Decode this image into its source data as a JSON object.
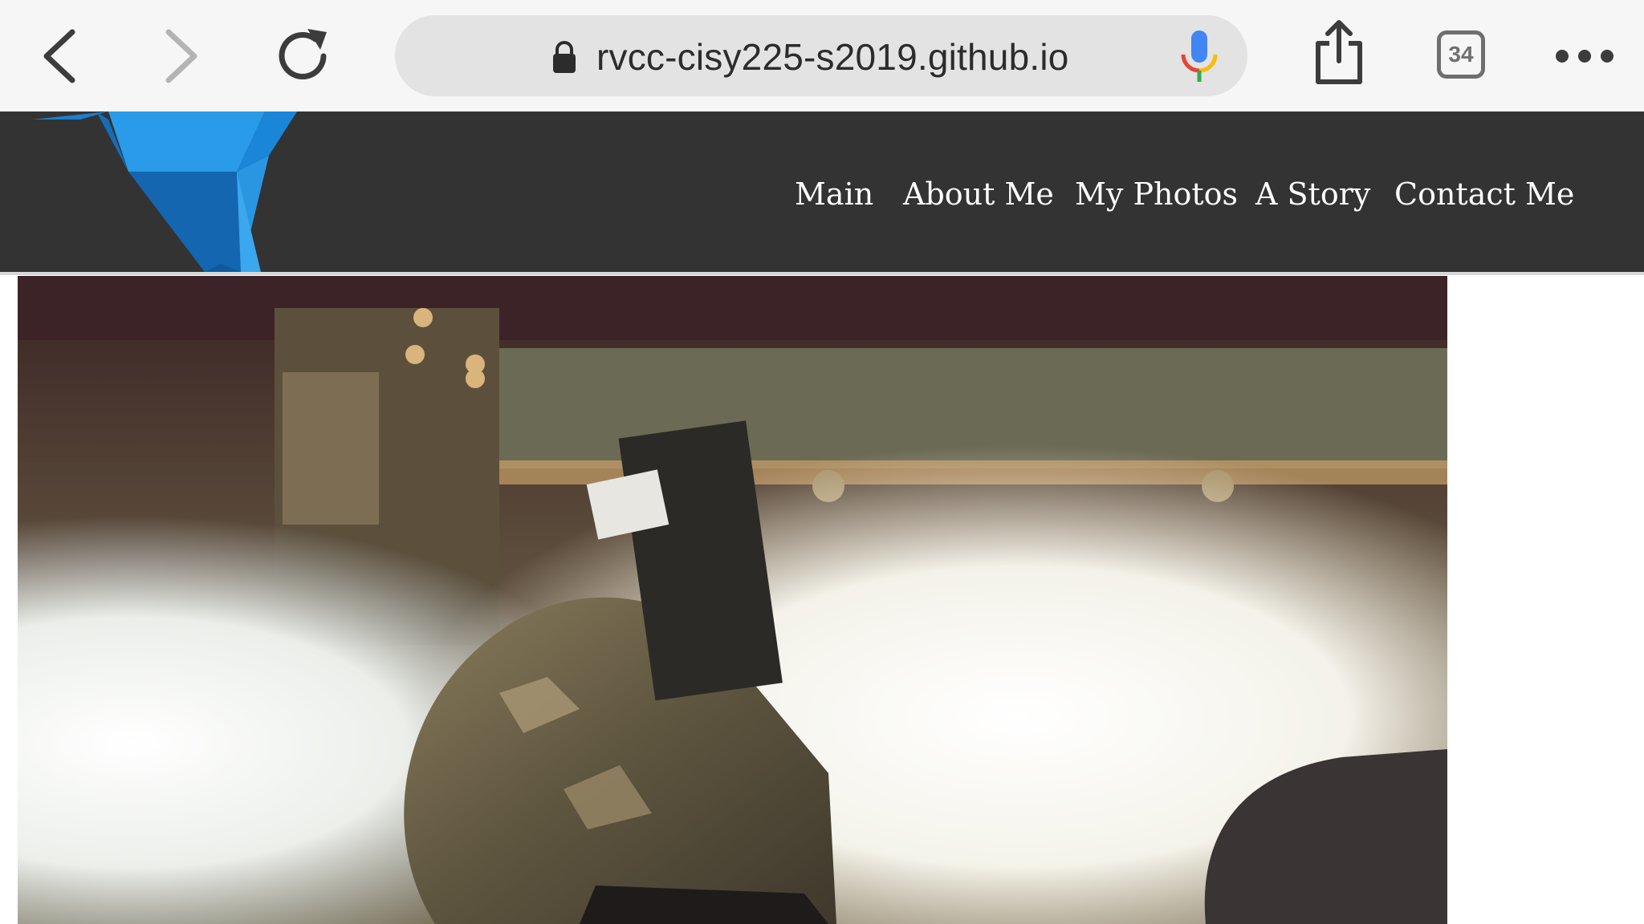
{
  "browser": {
    "url": "rvcc-cisy225-s2019.github.io",
    "tab_count": "34",
    "icons": {
      "back": "chevron-left-icon",
      "forward": "chevron-right-icon",
      "reload": "reload-icon",
      "lock": "lock-icon",
      "mic": "microphone-icon",
      "share": "share-icon",
      "tabs": "tabs-icon",
      "more": "more-dots-icon"
    }
  },
  "site": {
    "nav": [
      {
        "label": "Main"
      },
      {
        "label": "About Me"
      },
      {
        "label": "My Photos"
      },
      {
        "label": "A Story"
      },
      {
        "label": "Contact Me"
      }
    ],
    "colors": {
      "header_bg": "#333333",
      "logo_blue": "#1e8fe0",
      "nav_text": "#ffffff"
    }
  }
}
